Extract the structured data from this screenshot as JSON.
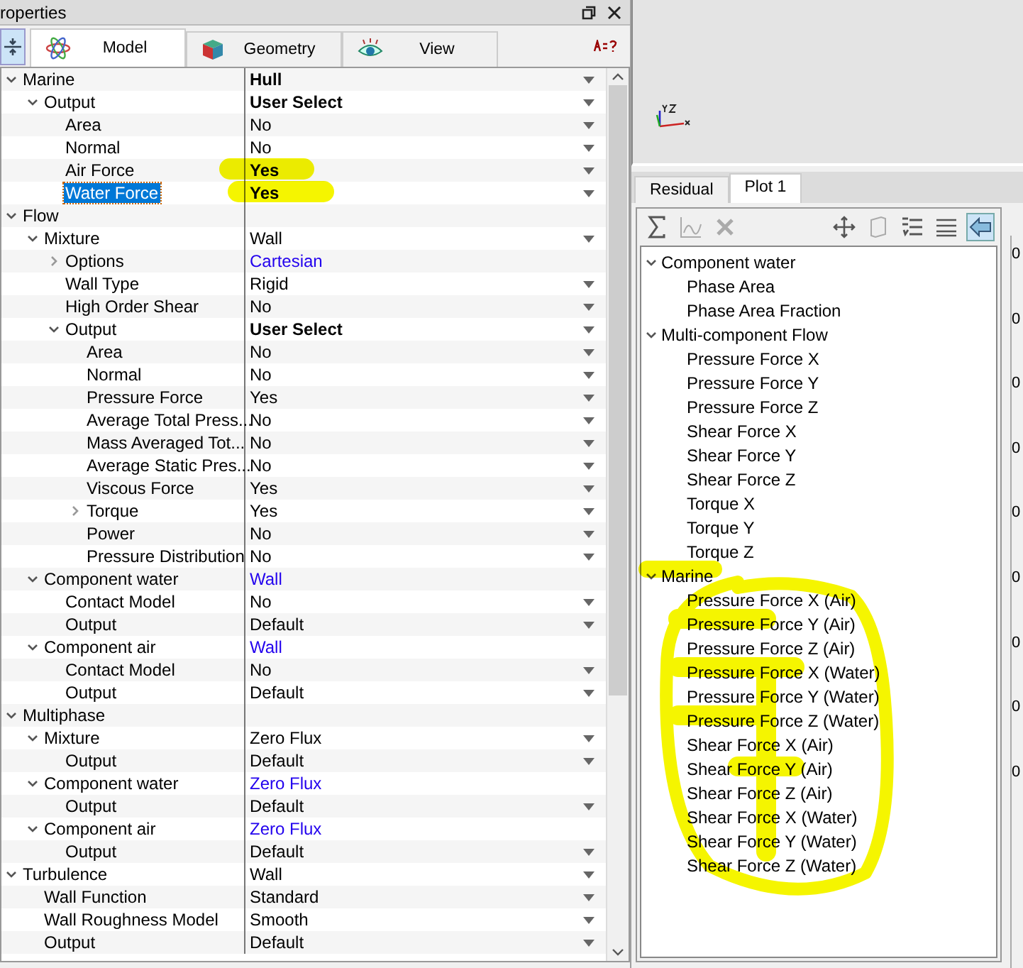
{
  "properties_panel": {
    "title": "roperties",
    "tabs": [
      {
        "label": "Model",
        "selected": true
      },
      {
        "label": "Geometry",
        "selected": false
      },
      {
        "label": "View",
        "selected": false
      }
    ],
    "tree": [
      {
        "label": "Marine",
        "expanded": true,
        "value": "Hull",
        "kind": "strong",
        "dropdown": true,
        "selected": false,
        "children": [
          {
            "label": "Output",
            "expanded": true,
            "value": "User Select",
            "kind": "strong",
            "dropdown": true,
            "selected": false,
            "children": [
              {
                "label": "Area",
                "value": "No",
                "kind": "plain",
                "dropdown": true,
                "selected": false
              },
              {
                "label": "Normal",
                "value": "No",
                "kind": "plain",
                "dropdown": true,
                "selected": false
              },
              {
                "label": "Air Force",
                "value": "Yes",
                "kind": "strong",
                "dropdown": true,
                "selected": false
              },
              {
                "label": "Water Force",
                "value": "Yes",
                "kind": "strong",
                "dropdown": true,
                "selected": true
              }
            ]
          }
        ]
      },
      {
        "label": "Flow",
        "expanded": true,
        "selected": false,
        "children": [
          {
            "label": "Mixture",
            "expanded": true,
            "value": "Wall",
            "kind": "plain",
            "dropdown": true,
            "selected": false,
            "children": [
              {
                "label": "Options",
                "expanded": false,
                "value": "Cartesian",
                "kind": "link",
                "dropdown": false,
                "selected": false
              },
              {
                "label": "Wall Type",
                "value": "Rigid",
                "kind": "plain",
                "dropdown": true,
                "selected": false
              },
              {
                "label": "High Order Shear",
                "value": "No",
                "kind": "plain",
                "dropdown": true,
                "selected": false
              },
              {
                "label": "Output",
                "expanded": true,
                "value": "User Select",
                "kind": "strong",
                "dropdown": true,
                "selected": false,
                "children": [
                  {
                    "label": "Area",
                    "value": "No",
                    "kind": "plain",
                    "dropdown": true,
                    "selected": false
                  },
                  {
                    "label": "Normal",
                    "value": "No",
                    "kind": "plain",
                    "dropdown": true,
                    "selected": false
                  },
                  {
                    "label": "Pressure Force",
                    "value": "Yes",
                    "kind": "plain",
                    "dropdown": true,
                    "selected": false
                  },
                  {
                    "label": "Average Total Press...",
                    "value": "No",
                    "kind": "plain",
                    "dropdown": true,
                    "selected": false
                  },
                  {
                    "label": "Mass Averaged Tot...",
                    "value": "No",
                    "kind": "plain",
                    "dropdown": true,
                    "selected": false
                  },
                  {
                    "label": "Average Static Pres...",
                    "value": "No",
                    "kind": "plain",
                    "dropdown": true,
                    "selected": false
                  },
                  {
                    "label": "Viscous Force",
                    "value": "Yes",
                    "kind": "plain",
                    "dropdown": true,
                    "selected": false
                  },
                  {
                    "label": "Torque",
                    "expanded": false,
                    "value": "Yes",
                    "kind": "plain",
                    "dropdown": true,
                    "selected": false
                  },
                  {
                    "label": "Power",
                    "value": "No",
                    "kind": "plain",
                    "dropdown": true,
                    "selected": false
                  },
                  {
                    "label": "Pressure Distribution",
                    "value": "No",
                    "kind": "plain",
                    "dropdown": true,
                    "selected": false
                  }
                ]
              }
            ]
          },
          {
            "label": "Component water",
            "expanded": true,
            "value": "Wall",
            "kind": "link",
            "dropdown": false,
            "selected": false,
            "children": [
              {
                "label": "Contact Model",
                "value": "No",
                "kind": "plain",
                "dropdown": true,
                "selected": false
              },
              {
                "label": "Output",
                "value": "Default",
                "kind": "plain",
                "dropdown": true,
                "selected": false
              }
            ]
          },
          {
            "label": "Component air",
            "expanded": true,
            "value": "Wall",
            "kind": "link",
            "dropdown": false,
            "selected": false,
            "children": [
              {
                "label": "Contact Model",
                "value": "No",
                "kind": "plain",
                "dropdown": true,
                "selected": false
              },
              {
                "label": "Output",
                "value": "Default",
                "kind": "plain",
                "dropdown": true,
                "selected": false
              }
            ]
          }
        ]
      },
      {
        "label": "Multiphase",
        "expanded": true,
        "selected": false,
        "children": [
          {
            "label": "Mixture",
            "expanded": true,
            "value": "Zero Flux",
            "kind": "plain",
            "dropdown": true,
            "selected": false,
            "children": [
              {
                "label": "Output",
                "value": "Default",
                "kind": "plain",
                "dropdown": true,
                "selected": false
              }
            ]
          },
          {
            "label": "Component water",
            "expanded": true,
            "value": "Zero Flux",
            "kind": "link",
            "dropdown": false,
            "selected": false,
            "children": [
              {
                "label": "Output",
                "value": "Default",
                "kind": "plain",
                "dropdown": true,
                "selected": false
              }
            ]
          },
          {
            "label": "Component air",
            "expanded": true,
            "value": "Zero Flux",
            "kind": "link",
            "dropdown": false,
            "selected": false,
            "children": [
              {
                "label": "Output",
                "value": "Default",
                "kind": "plain",
                "dropdown": true,
                "selected": false
              }
            ]
          }
        ]
      },
      {
        "label": "Turbulence",
        "expanded": true,
        "value": "Wall",
        "kind": "plain",
        "dropdown": true,
        "selected": false,
        "children": [
          {
            "label": "Wall Function",
            "value": "Standard",
            "kind": "plain",
            "dropdown": true,
            "selected": false
          },
          {
            "label": "Wall Roughness Model",
            "value": "Smooth",
            "kind": "plain",
            "dropdown": true,
            "selected": false
          },
          {
            "label": "Output",
            "value": "Default",
            "kind": "plain",
            "dropdown": true,
            "selected": false
          }
        ]
      }
    ]
  },
  "plot_panel": {
    "tabs": [
      {
        "label": "Residual",
        "selected": false
      },
      {
        "label": "Plot 1",
        "selected": true
      }
    ],
    "toolbar": [
      {
        "disabled": false,
        "pressed": false
      },
      {
        "disabled": true,
        "pressed": false
      },
      {
        "disabled": true,
        "pressed": false
      },
      {
        "disabled": false,
        "pressed": false
      },
      {
        "disabled": true,
        "pressed": false
      },
      {
        "disabled": false,
        "pressed": false
      },
      {
        "disabled": false,
        "pressed": false
      },
      {
        "disabled": false,
        "pressed": true
      }
    ],
    "variables": [
      {
        "label": "Component water",
        "expanded": true,
        "children": [
          {
            "label": "Phase Area"
          },
          {
            "label": "Phase Area Fraction"
          }
        ]
      },
      {
        "label": "Multi-component Flow",
        "expanded": true,
        "children": [
          {
            "label": "Pressure Force X"
          },
          {
            "label": "Pressure Force Y"
          },
          {
            "label": "Pressure Force Z"
          },
          {
            "label": "Shear Force X"
          },
          {
            "label": "Shear Force Y"
          },
          {
            "label": "Shear Force Z"
          },
          {
            "label": "Torque X"
          },
          {
            "label": "Torque Y"
          },
          {
            "label": "Torque Z"
          }
        ]
      },
      {
        "label": "Marine",
        "expanded": true,
        "children": [
          {
            "label": "Pressure Force X (Air)"
          },
          {
            "label": "Pressure Force Y (Air)"
          },
          {
            "label": "Pressure Force Z (Air)"
          },
          {
            "label": "Pressure Force X (Water)"
          },
          {
            "label": "Pressure Force Y (Water)"
          },
          {
            "label": "Pressure Force Z (Water)"
          },
          {
            "label": "Shear Force X (Air)"
          },
          {
            "label": "Shear Force Y (Air)"
          },
          {
            "label": "Shear Force Z (Air)"
          },
          {
            "label": "Shear Force X (Water)"
          },
          {
            "label": "Shear Force Y (Water)"
          },
          {
            "label": "Shear Force Z (Water)"
          }
        ]
      }
    ],
    "axis_labels": [
      "0",
      "0",
      "0",
      "0",
      "0",
      "0",
      "0",
      "0",
      "0"
    ]
  }
}
